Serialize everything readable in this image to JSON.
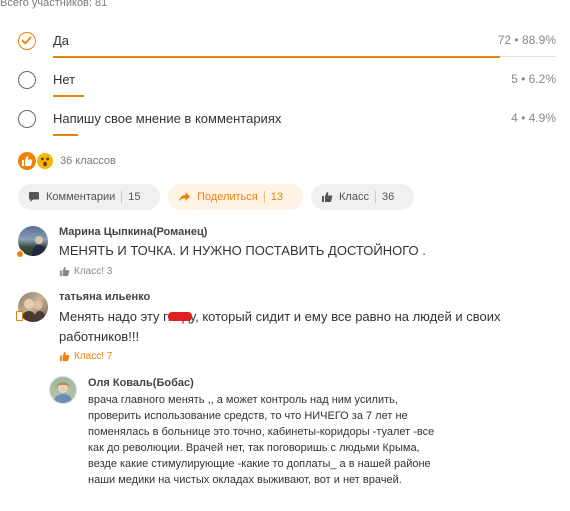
{
  "poll": {
    "total_participants": "Всего участников: 81",
    "options": [
      {
        "label": "Да",
        "stats": "72 • 88.9%",
        "fraction": 0.889,
        "selected": true
      },
      {
        "label": "Нет",
        "stats": "5 • 6.2%",
        "fraction": 0.062,
        "selected": false
      },
      {
        "label": "Напишу свое мнение в комментариях",
        "stats": "4 • 4.9%",
        "fraction": 0.049,
        "selected": false
      }
    ]
  },
  "reactions": {
    "icons": [
      "thumbs-up-icon",
      "wow-emoji-icon"
    ],
    "count_label": "36 классов"
  },
  "actions": {
    "comments_label": "Комментарии",
    "comments_count": "15",
    "share_label": "Поделиться",
    "share_count": "13",
    "like_label": "Класс",
    "like_count": "36"
  },
  "comments": [
    {
      "author": "Марина Цыпкина(Романец)",
      "text": "МЕНЯТЬ И ТОЧКА. И НУЖНО ПОСТАВИТЬ ДОСТОЙНОГО .",
      "klass": "Класс! 3"
    },
    {
      "author": "татьяна ильенко",
      "text": "Менять надо эту гниду, который сидит и ему все равно на людей и своих работников!!!",
      "klass": "Класс! 7"
    }
  ],
  "reply": {
    "author": "Оля Коваль(Бобас)",
    "text": "врача главного менять ,, а может контроль над ним усилить, проверить использование средств, то что НИЧЕГО за 7 лет не поменялась в больнице это точно, кабинеты-коридоры -туалет -все как до революции. Врачей нет, так поговоришь с людьми Крыма, везде какие стимулирующие -какие то доплаты_ а в нашей районе наши медики на чистых окладах выживают, вот и нет врачей."
  },
  "colors": {
    "accent": "#ee8208",
    "text": "#333333",
    "muted": "#888888"
  }
}
